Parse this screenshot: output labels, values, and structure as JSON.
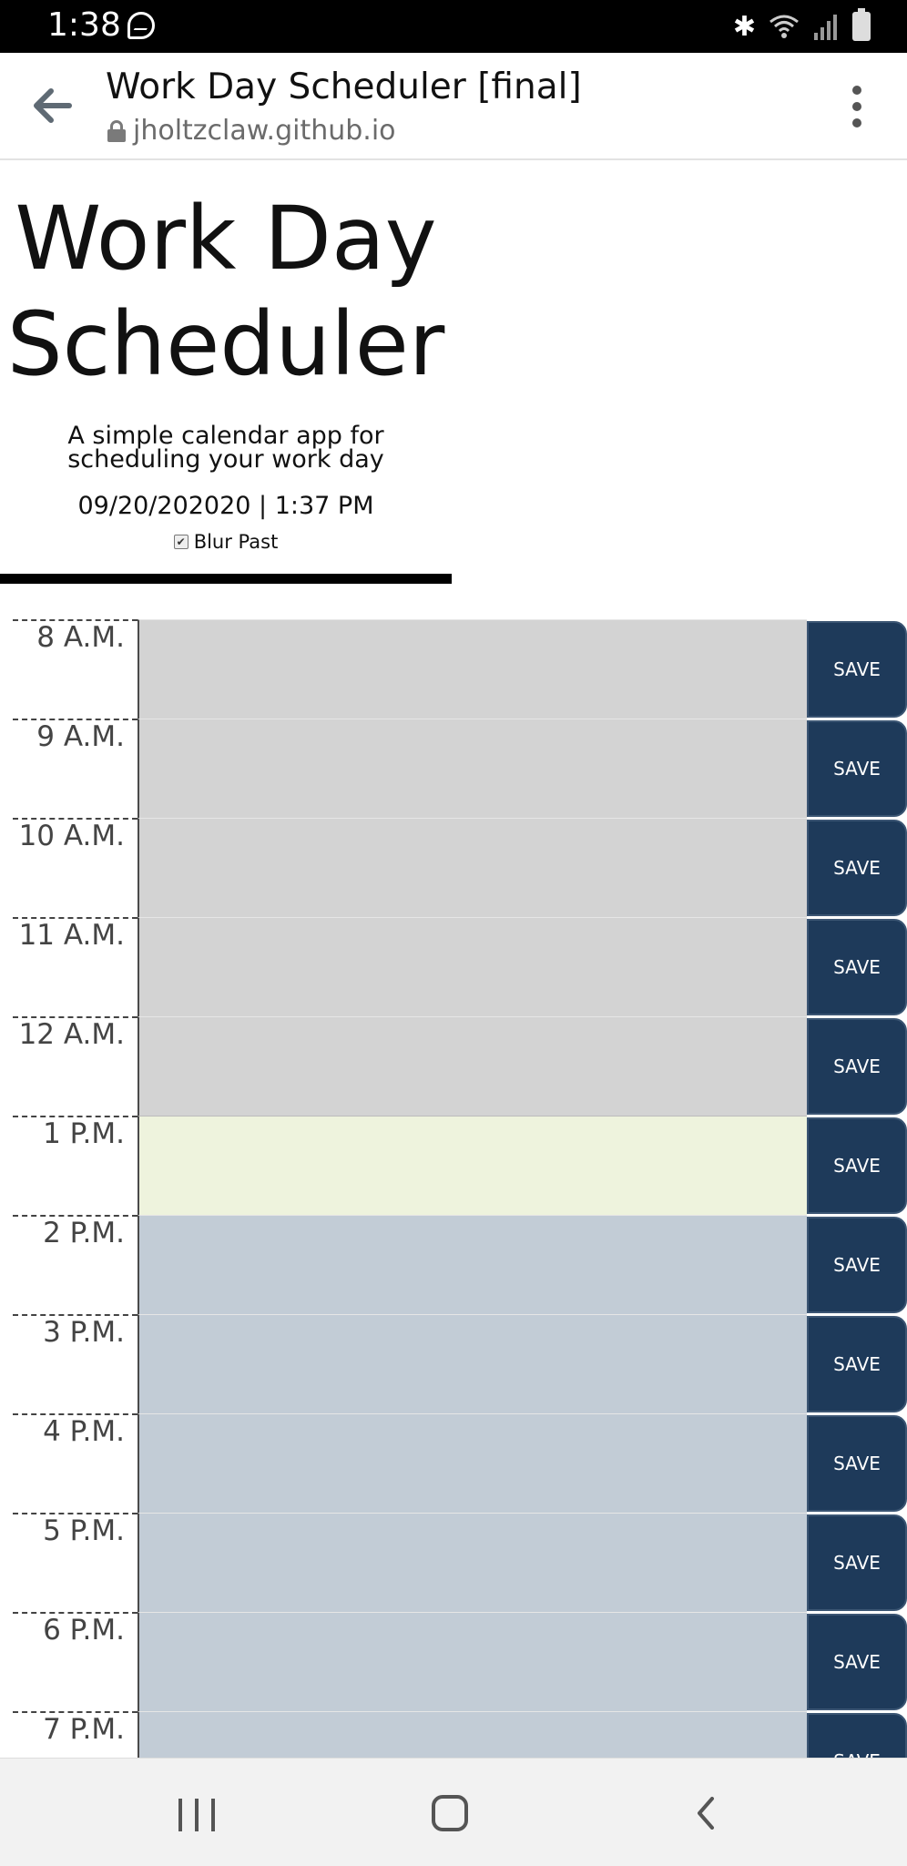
{
  "status_bar": {
    "time": "1:38"
  },
  "browser": {
    "page_title": "Work Day Scheduler [final]",
    "url": "jholtzclaw.github.io"
  },
  "header": {
    "title_line1": "Work Day",
    "title_line2": "Scheduler",
    "lead": "A simple calendar app for scheduling your work day",
    "current_day": "09/20/202020 | 1:37 PM",
    "blur_label": "Blur Past"
  },
  "schedule": {
    "save_label": "SAVE",
    "hours": [
      {
        "label": "8 A.M.",
        "state": "past",
        "text": ""
      },
      {
        "label": "9 A.M.",
        "state": "past",
        "text": ""
      },
      {
        "label": "10 A.M.",
        "state": "past",
        "text": ""
      },
      {
        "label": "11 A.M.",
        "state": "past",
        "text": ""
      },
      {
        "label": "12 A.M.",
        "state": "past",
        "text": ""
      },
      {
        "label": "1 P.M.",
        "state": "present",
        "text": ""
      },
      {
        "label": "2 P.M.",
        "state": "future",
        "text": ""
      },
      {
        "label": "3 P.M.",
        "state": "future",
        "text": ""
      },
      {
        "label": "4 P.M.",
        "state": "future",
        "text": ""
      },
      {
        "label": "5 P.M.",
        "state": "future",
        "text": ""
      },
      {
        "label": "6 P.M.",
        "state": "future",
        "text": ""
      },
      {
        "label": "7 P.M.",
        "state": "future",
        "text": ""
      }
    ]
  },
  "colors": {
    "past": "#d3d3d3",
    "present": "#eef3dd",
    "future": "#c2ccd6",
    "save_button": "#1e3a5a"
  }
}
